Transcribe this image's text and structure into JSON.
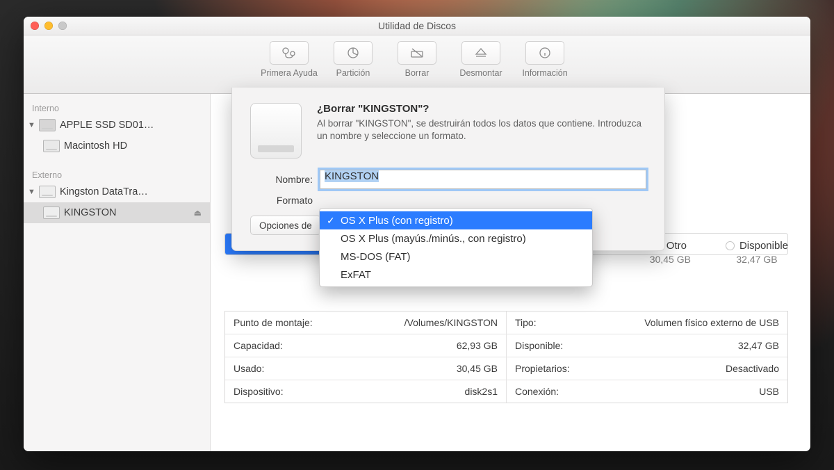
{
  "window": {
    "title": "Utilidad de Discos"
  },
  "toolbar": {
    "items": [
      {
        "label": "Primera Ayuda"
      },
      {
        "label": "Partición"
      },
      {
        "label": "Borrar"
      },
      {
        "label": "Desmontar"
      },
      {
        "label": "Información"
      }
    ]
  },
  "sidebar": {
    "sections": [
      {
        "header": "Interno",
        "rows": [
          {
            "label": "APPLE SSD SD01…",
            "kind": "ssd",
            "disclosure": true
          },
          {
            "label": "Macintosh HD",
            "kind": "hd",
            "child": true
          }
        ]
      },
      {
        "header": "Externo",
        "rows": [
          {
            "label": "Kingston DataTra…",
            "kind": "ext",
            "disclosure": true
          },
          {
            "label": "KINGSTON",
            "kind": "ext",
            "child": true,
            "selected": true,
            "ejectable": true
          }
        ]
      }
    ]
  },
  "legend": {
    "other": {
      "title": "Otro",
      "value": "30,45 GB"
    },
    "available": {
      "title": "Disponible",
      "value": "32,47 GB"
    }
  },
  "details": [
    [
      {
        "label": "Punto de montaje:",
        "value": "/Volumes/KINGSTON"
      },
      {
        "label": "Tipo:",
        "value": "Volumen físico externo de USB"
      }
    ],
    [
      {
        "label": "Capacidad:",
        "value": "62,93 GB"
      },
      {
        "label": "Disponible:",
        "value": "32,47 GB"
      }
    ],
    [
      {
        "label": "Usado:",
        "value": "30,45 GB"
      },
      {
        "label": "Propietarios:",
        "value": "Desactivado"
      }
    ],
    [
      {
        "label": "Dispositivo:",
        "value": "disk2s1"
      },
      {
        "label": "Conexión:",
        "value": "USB"
      }
    ]
  ],
  "sheet": {
    "title": "¿Borrar \"KINGSTON\"?",
    "subtitle": "Al borrar \"KINGSTON\", se destruirán todos los datos que contiene. Introduzca un nombre y seleccione un formato.",
    "name_label": "Nombre:",
    "name_value": "KINGSTON",
    "format_label": "Formato",
    "options_btn": "Opciones de"
  },
  "dropdown": {
    "options": [
      "OS X Plus (con registro)",
      "OS X Plus (mayús./minús., con registro)",
      "MS-DOS (FAT)",
      "ExFAT"
    ],
    "selected_index": 0
  }
}
